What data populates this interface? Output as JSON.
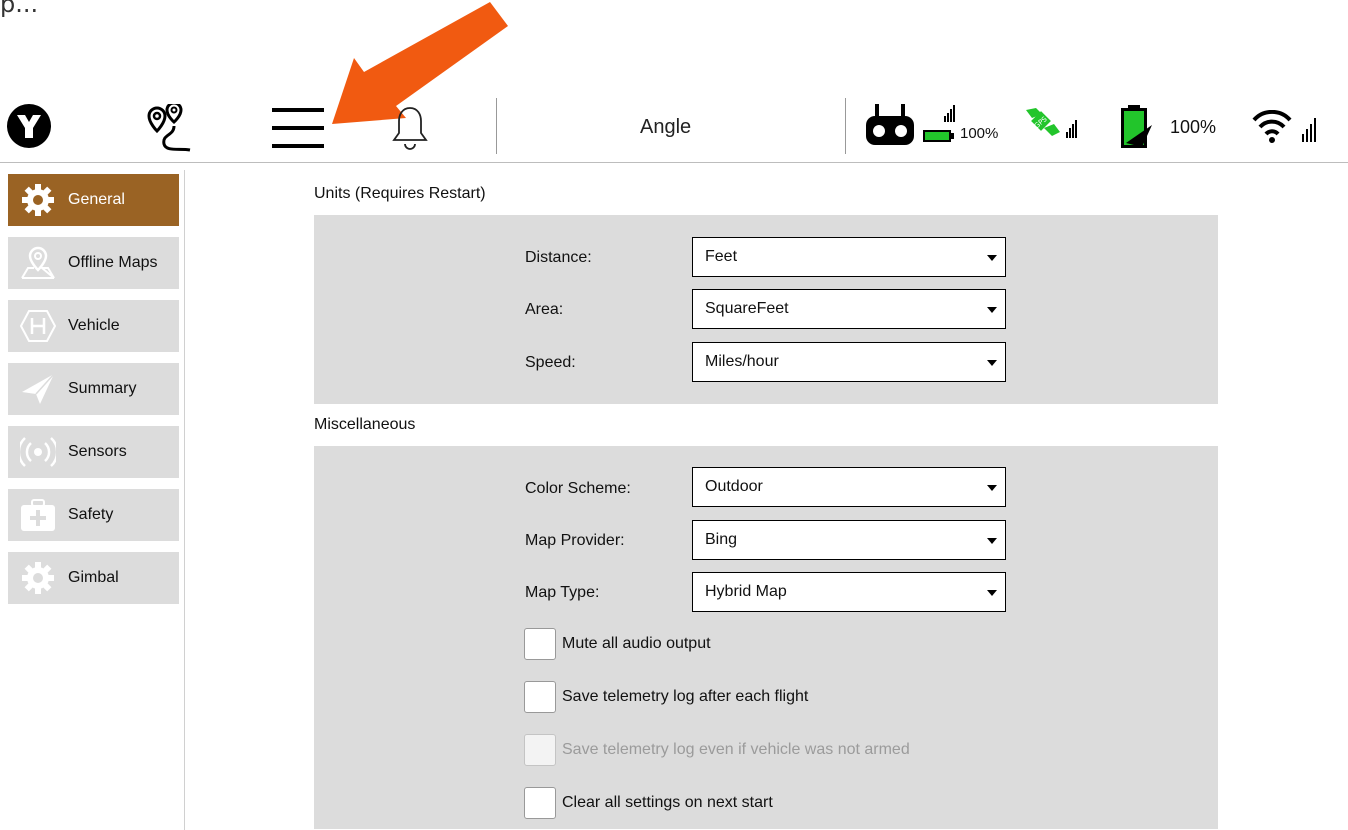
{
  "cutoff_text": "p...",
  "toolbar": {
    "mode": "Angle",
    "rc_battery_pct": "100%",
    "vehicle_battery_pct": "100%",
    "icons": [
      "app-logo-icon",
      "plan-view-icon",
      "hamburger-menu-icon",
      "bell-icon",
      "rc-controller-icon",
      "gps-icon",
      "battery-icon",
      "wifi-icon"
    ]
  },
  "sidebar": {
    "items": [
      {
        "label": "General",
        "active": true
      },
      {
        "label": "Offline Maps"
      },
      {
        "label": "Vehicle"
      },
      {
        "label": "Summary"
      },
      {
        "label": "Sensors"
      },
      {
        "label": "Safety"
      },
      {
        "label": "Gimbal"
      }
    ]
  },
  "units": {
    "title": "Units (Requires Restart)",
    "distance": {
      "label": "Distance:",
      "value": "Feet"
    },
    "area": {
      "label": "Area:",
      "value": "SquareFeet"
    },
    "speed": {
      "label": "Speed:",
      "value": "Miles/hour"
    }
  },
  "misc": {
    "title": "Miscellaneous",
    "color_scheme": {
      "label": "Color Scheme:",
      "value": "Outdoor"
    },
    "map_provider": {
      "label": "Map Provider:",
      "value": "Bing"
    },
    "map_type": {
      "label": "Map Type:",
      "value": "Hybrid Map"
    },
    "checkboxes": [
      {
        "label": "Mute all audio output"
      },
      {
        "label": "Save telemetry log after each flight"
      },
      {
        "label": "Save telemetry log even if vehicle was not armed",
        "disabled": true
      },
      {
        "label": "Clear all settings on next start"
      }
    ]
  },
  "colors": {
    "accent": "#9a6324",
    "arrow": "#f15a11",
    "battery_green": "#22c52b",
    "panel": "#dcdcdc"
  }
}
